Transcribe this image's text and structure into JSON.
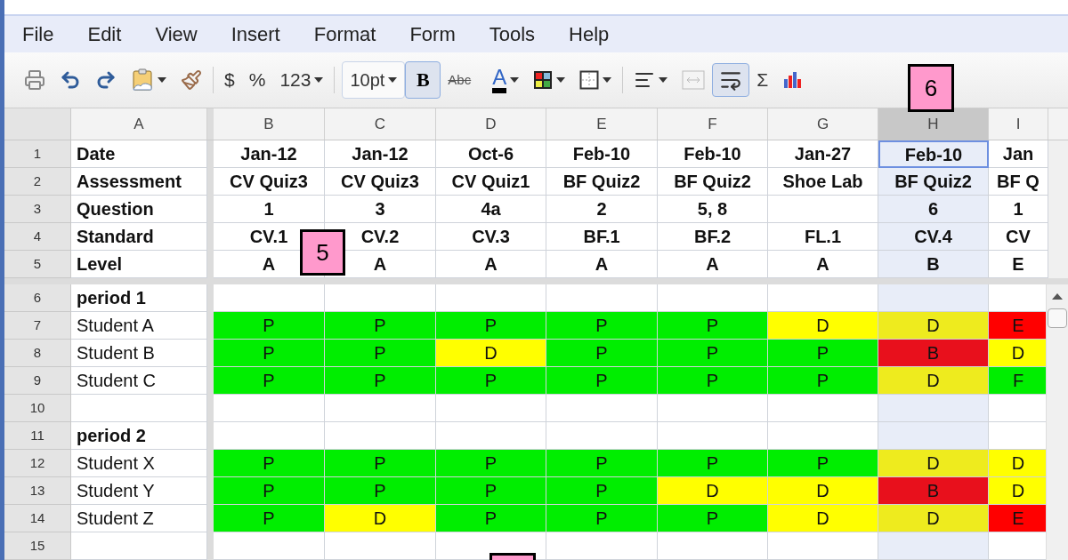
{
  "menu": [
    "File",
    "Edit",
    "View",
    "Insert",
    "Format",
    "Form",
    "Tools",
    "Help"
  ],
  "toolbar": [
    {
      "kind": "print"
    },
    {
      "kind": "undo"
    },
    {
      "kind": "redo"
    },
    {
      "kind": "paste"
    },
    {
      "kind": "brush"
    },
    {
      "kind": "separator"
    },
    {
      "kind": "text",
      "label": "$"
    },
    {
      "kind": "text",
      "label": "%"
    },
    {
      "kind": "format",
      "label": "123"
    },
    {
      "kind": "separator"
    },
    {
      "kind": "dropdown",
      "label": "10pt"
    },
    {
      "kind": "bold",
      "label": "B",
      "pressed": true
    },
    {
      "kind": "strike",
      "label": "Abc"
    },
    {
      "kind": "textcolor",
      "label": "A"
    },
    {
      "kind": "fill"
    },
    {
      "kind": "borders"
    },
    {
      "kind": "separator"
    },
    {
      "kind": "align"
    },
    {
      "kind": "merge",
      "disabled": true
    },
    {
      "kind": "wrap",
      "pressed": true
    },
    {
      "kind": "text",
      "label": "Σ"
    },
    {
      "kind": "chart"
    }
  ],
  "columns": [
    {
      "label": "A",
      "selected": false
    },
    {
      "label": "B",
      "selected": false
    },
    {
      "label": "C",
      "selected": false
    },
    {
      "label": "D",
      "selected": false
    },
    {
      "label": "E",
      "selected": false
    },
    {
      "label": "F",
      "selected": false
    },
    {
      "label": "G",
      "selected": false
    },
    {
      "label": "H",
      "selected": true
    },
    {
      "label": "I",
      "selected": false
    }
  ],
  "rows": [
    {
      "number": "1",
      "kind": "header",
      "cells": [
        {
          "text": "Date"
        },
        {
          "text": "Jan-12"
        },
        {
          "text": "Jan-12"
        },
        {
          "text": "Oct-6"
        },
        {
          "text": "Feb-10"
        },
        {
          "text": "Feb-10"
        },
        {
          "text": "Jan-27"
        },
        {
          "text": "Feb-10"
        },
        {
          "text": "Jan"
        }
      ]
    },
    {
      "number": "2",
      "kind": "header",
      "cells": [
        {
          "text": "Assessment"
        },
        {
          "text": "CV Quiz3"
        },
        {
          "text": "CV Quiz3"
        },
        {
          "text": "CV Quiz1"
        },
        {
          "text": "BF Quiz2"
        },
        {
          "text": "BF Quiz2"
        },
        {
          "text": "Shoe Lab"
        },
        {
          "text": "BF Quiz2"
        },
        {
          "text": "BF Q"
        }
      ]
    },
    {
      "number": "3",
      "kind": "header",
      "cells": [
        {
          "text": "Question"
        },
        {
          "text": "1"
        },
        {
          "text": "3"
        },
        {
          "text": "4a"
        },
        {
          "text": "2"
        },
        {
          "text": "5, 8"
        },
        {
          "text": ""
        },
        {
          "text": "6"
        },
        {
          "text": "1"
        }
      ]
    },
    {
      "number": "4",
      "kind": "header",
      "cells": [
        {
          "text": "Standard"
        },
        {
          "text": "CV.1"
        },
        {
          "text": "CV.2"
        },
        {
          "text": "CV.3"
        },
        {
          "text": "BF.1"
        },
        {
          "text": "BF.2"
        },
        {
          "text": "FL.1"
        },
        {
          "text": "CV.4"
        },
        {
          "text": "CV"
        }
      ]
    },
    {
      "number": "5",
      "kind": "header",
      "cells": [
        {
          "text": "Level"
        },
        {
          "text": "A"
        },
        {
          "text": "A"
        },
        {
          "text": "A"
        },
        {
          "text": "A"
        },
        {
          "text": "A"
        },
        {
          "text": "A"
        },
        {
          "text": "B"
        },
        {
          "text": "E"
        }
      ]
    },
    {
      "number": "6",
      "kind": "section",
      "cells": [
        {
          "text": "period 1"
        }
      ]
    },
    {
      "number": "7",
      "kind": "student",
      "cells": [
        {
          "text": "Student A"
        },
        {
          "text": "P",
          "color": "#00ee00"
        },
        {
          "text": "P",
          "color": "#00ee00"
        },
        {
          "text": "P",
          "color": "#00ee00"
        },
        {
          "text": "P",
          "color": "#00ee00"
        },
        {
          "text": "P",
          "color": "#00ee00"
        },
        {
          "text": "D",
          "color": "#ffff00"
        },
        {
          "text": "D",
          "color": "#eeeb1e"
        },
        {
          "text": "E",
          "color": "#ff0000"
        }
      ]
    },
    {
      "number": "8",
      "kind": "student",
      "cells": [
        {
          "text": "Student B"
        },
        {
          "text": "P",
          "color": "#00ee00"
        },
        {
          "text": "P",
          "color": "#00ee00"
        },
        {
          "text": "D",
          "color": "#ffff00"
        },
        {
          "text": "P",
          "color": "#00ee00"
        },
        {
          "text": "P",
          "color": "#00ee00"
        },
        {
          "text": "P",
          "color": "#00ee00"
        },
        {
          "text": "B",
          "color": "#e8101c"
        },
        {
          "text": "D",
          "color": "#ffff00"
        }
      ]
    },
    {
      "number": "9",
      "kind": "student",
      "cells": [
        {
          "text": "Student C"
        },
        {
          "text": "P",
          "color": "#00ee00"
        },
        {
          "text": "P",
          "color": "#00ee00"
        },
        {
          "text": "P",
          "color": "#00ee00"
        },
        {
          "text": "P",
          "color": "#00ee00"
        },
        {
          "text": "P",
          "color": "#00ee00"
        },
        {
          "text": "P",
          "color": "#00ee00"
        },
        {
          "text": "D",
          "color": "#eeeb1e"
        },
        {
          "text": "F",
          "color": "#00ee00"
        }
      ]
    },
    {
      "number": "10",
      "kind": "blank",
      "cells": []
    },
    {
      "number": "11",
      "kind": "section",
      "cells": [
        {
          "text": "period 2"
        }
      ]
    },
    {
      "number": "12",
      "kind": "student",
      "cells": [
        {
          "text": "Student X"
        },
        {
          "text": "P",
          "color": "#00ee00"
        },
        {
          "text": "P",
          "color": "#00ee00"
        },
        {
          "text": "P",
          "color": "#00ee00"
        },
        {
          "text": "P",
          "color": "#00ee00"
        },
        {
          "text": "P",
          "color": "#00ee00"
        },
        {
          "text": "P",
          "color": "#00ee00"
        },
        {
          "text": "D",
          "color": "#eeeb1e"
        },
        {
          "text": "D",
          "color": "#ffff00"
        }
      ]
    },
    {
      "number": "13",
      "kind": "student",
      "cells": [
        {
          "text": "Student Y"
        },
        {
          "text": "P",
          "color": "#00ee00"
        },
        {
          "text": "P",
          "color": "#00ee00"
        },
        {
          "text": "P",
          "color": "#00ee00"
        },
        {
          "text": "P",
          "color": "#00ee00"
        },
        {
          "text": "D",
          "color": "#ffff00"
        },
        {
          "text": "D",
          "color": "#ffff00"
        },
        {
          "text": "B",
          "color": "#e8101c"
        },
        {
          "text": "D",
          "color": "#ffff00"
        }
      ]
    },
    {
      "number": "14",
      "kind": "student",
      "cells": [
        {
          "text": "Student Z"
        },
        {
          "text": "P",
          "color": "#00ee00"
        },
        {
          "text": "D",
          "color": "#ffff00"
        },
        {
          "text": "P",
          "color": "#00ee00"
        },
        {
          "text": "P",
          "color": "#00ee00"
        },
        {
          "text": "P",
          "color": "#00ee00"
        },
        {
          "text": "D",
          "color": "#ffff00"
        },
        {
          "text": "D",
          "color": "#eeeb1e"
        },
        {
          "text": "E",
          "color": "#ff0000"
        }
      ]
    },
    {
      "number": "15",
      "kind": "blank",
      "cells": []
    }
  ],
  "callouts": [
    {
      "label": "5"
    },
    {
      "label": "6"
    }
  ],
  "partial_callout": true
}
